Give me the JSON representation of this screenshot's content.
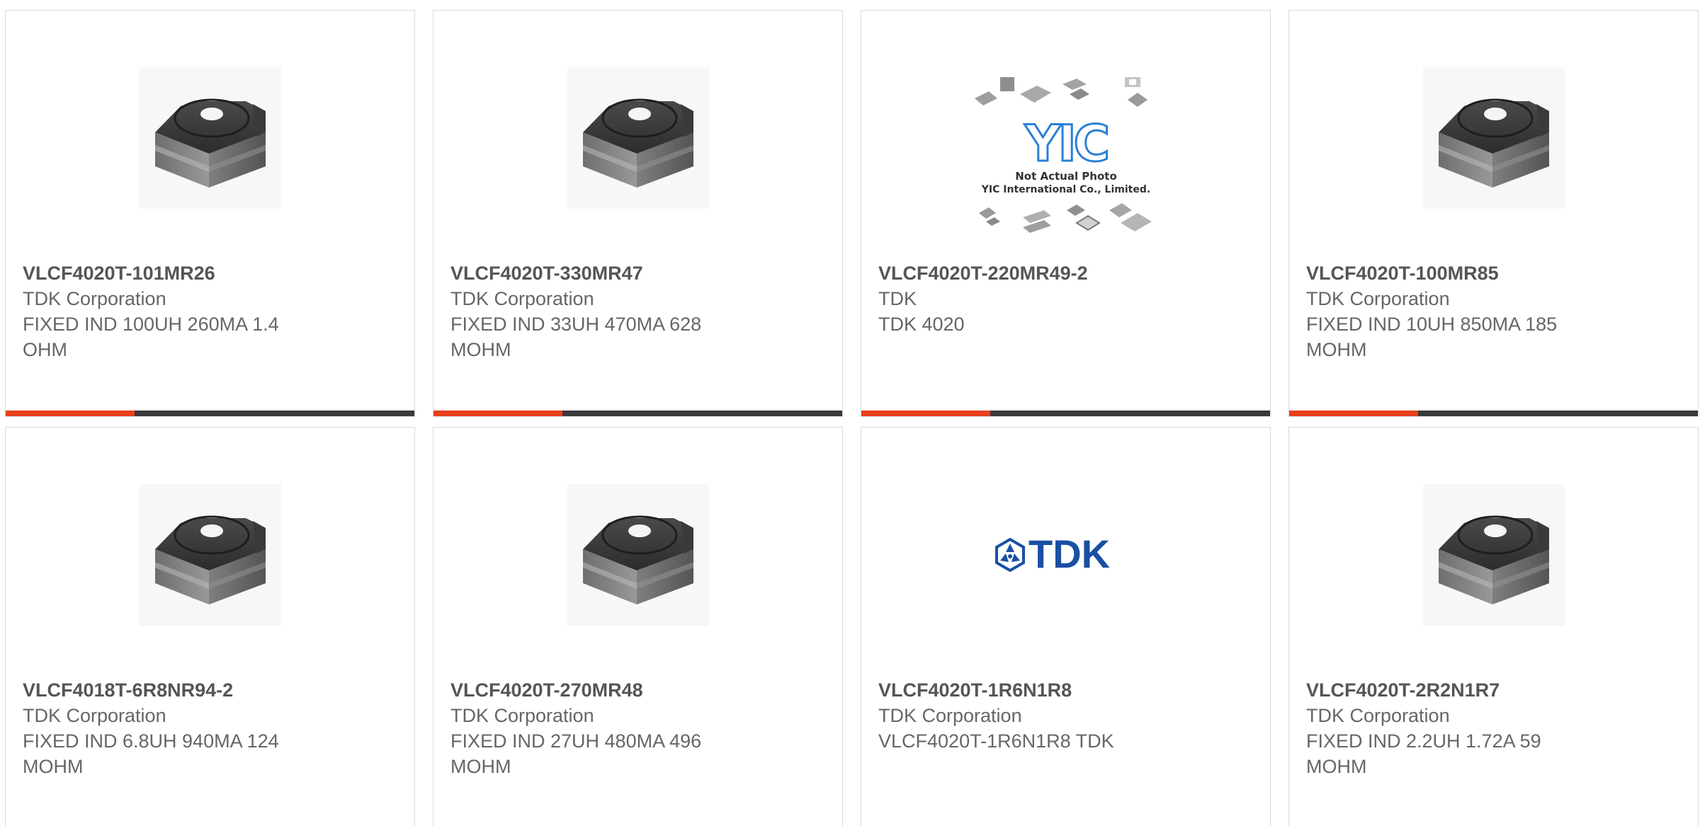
{
  "colors": {
    "accent": "#e8401c",
    "bar": "#3a3a3a",
    "border": "#d9d9d9",
    "part_text": "#555555",
    "body_text": "#666666",
    "tdk_blue": "#1a4fa3",
    "yic_blue": "#2a7fd6"
  },
  "products": [
    {
      "part_number": "VLCF4020T-101MR26",
      "manufacturer": "TDK Corporation",
      "description": "FIXED IND 100UH 260MA 1.4 OHM",
      "image": "inductor-photo"
    },
    {
      "part_number": "VLCF4020T-330MR47",
      "manufacturer": "TDK Corporation",
      "description": "FIXED IND 33UH 470MA 628 MOHM",
      "image": "inductor-photo"
    },
    {
      "part_number": "VLCF4020T-220MR49-2",
      "manufacturer": "TDK",
      "description": "TDK 4020",
      "image": "yic-placeholder",
      "placeholder_line1": "Not Actual Photo",
      "placeholder_line2": "YIC International Co., Limited.",
      "placeholder_logo": "YIC"
    },
    {
      "part_number": "VLCF4020T-100MR85",
      "manufacturer": "TDK Corporation",
      "description": "FIXED IND 10UH 850MA 185 MOHM",
      "image": "inductor-photo"
    },
    {
      "part_number": "VLCF4018T-6R8NR94-2",
      "manufacturer": "TDK Corporation",
      "description": "FIXED IND 6.8UH 940MA 124 MOHM",
      "image": "inductor-photo"
    },
    {
      "part_number": "VLCF4020T-270MR48",
      "manufacturer": "TDK Corporation",
      "description": "FIXED IND 27UH 480MA 496 MOHM",
      "image": "inductor-photo"
    },
    {
      "part_number": "VLCF4020T-1R6N1R8",
      "manufacturer": "TDK Corporation",
      "description": "VLCF4020T-1R6N1R8 TDK",
      "image": "tdk-logo",
      "logo_text": "TDK"
    },
    {
      "part_number": "VLCF4020T-2R2N1R7",
      "manufacturer": "TDK Corporation",
      "description": "FIXED IND 2.2UH 1.72A 59 MOHM",
      "image": "inductor-photo"
    }
  ]
}
